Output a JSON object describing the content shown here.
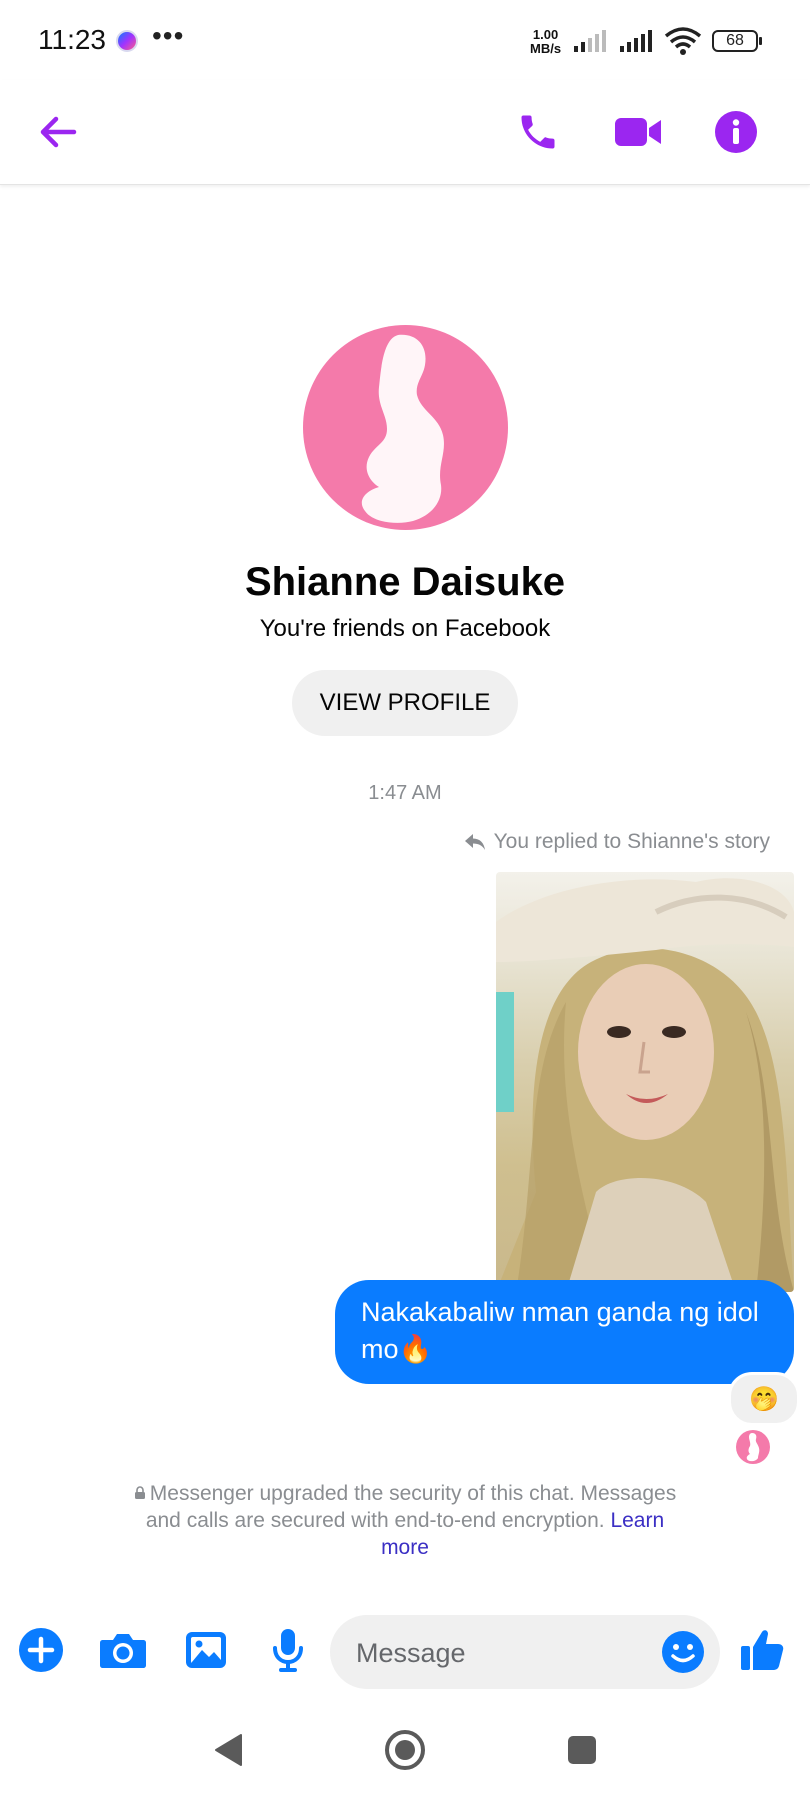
{
  "status_bar": {
    "time": "11:23",
    "more": "•••",
    "net_speed_value": "1.00",
    "net_speed_unit": "MB/s",
    "battery": "68"
  },
  "app_bar": {
    "accent_color": "#9b26f0",
    "icons": [
      "back-arrow-icon",
      "phone-icon",
      "video-call-icon",
      "info-icon"
    ]
  },
  "profile": {
    "name": "Shianne Daisuke",
    "subtitle": "You're friends on Facebook",
    "view_profile_label": "VIEW PROFILE"
  },
  "chat": {
    "timestamp": "1:47 AM",
    "reply_note": "You replied to Shianne's story",
    "message_text": "Nakakabaliw nman ganda ng idol mo",
    "message_emoji": "🔥",
    "reaction": "🤭",
    "bubble_color": "#0a7cff",
    "security_text": "Messenger upgraded the security of this chat. Messages and calls are secured with end-to-end encryption.",
    "security_link": "Learn more"
  },
  "composer": {
    "placeholder": "Message",
    "icons": [
      "plus-icon",
      "camera-icon",
      "gallery-icon",
      "microphone-icon",
      "emoji-icon",
      "thumbs-up-icon"
    ],
    "accent_color": "#0a7cff"
  },
  "nav_bar": {
    "icons": [
      "back-triangle-icon",
      "home-circle-icon",
      "recents-square-icon"
    ]
  }
}
